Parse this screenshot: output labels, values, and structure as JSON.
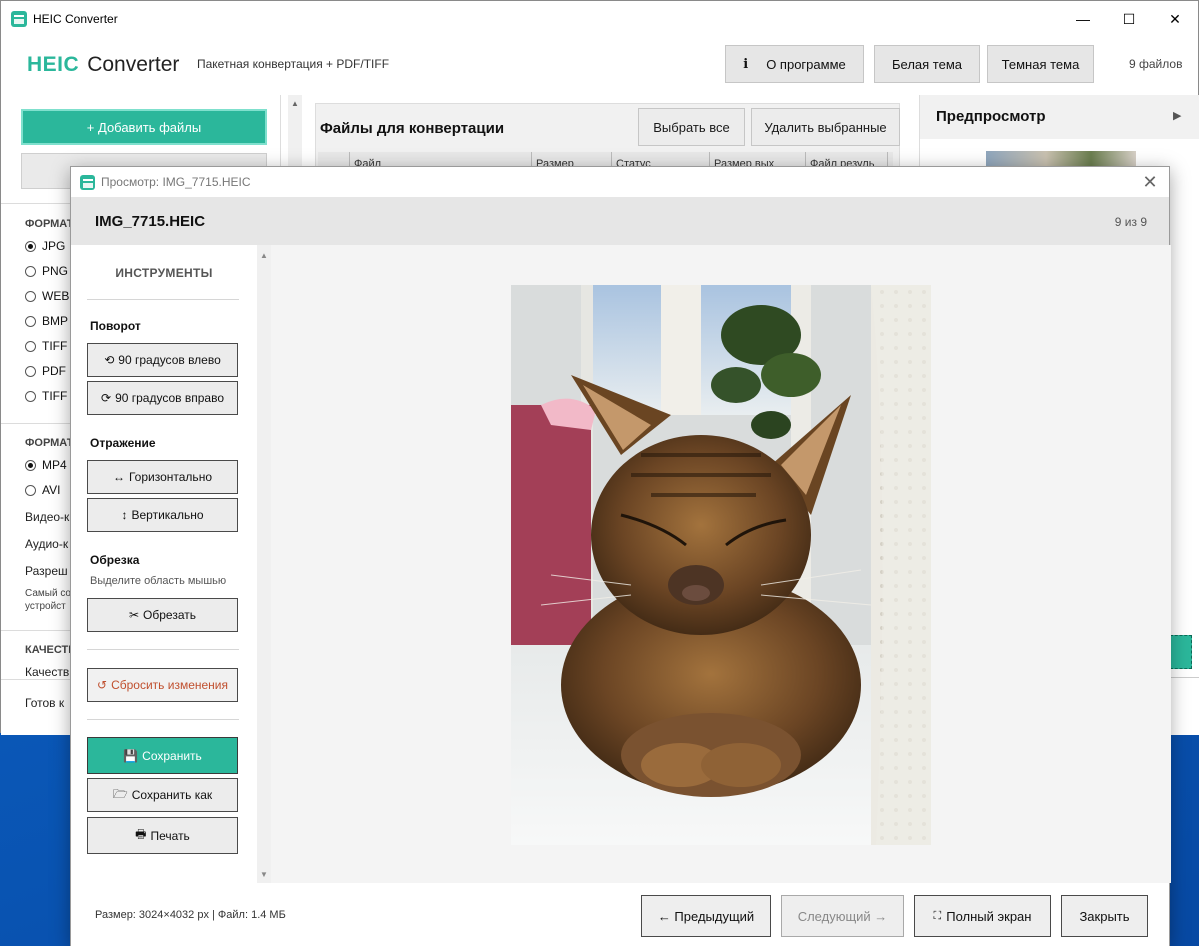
{
  "window": {
    "title": "HEIC Converter",
    "controls": [
      "—",
      "☐",
      "✕"
    ]
  },
  "header": {
    "brand_1": "HEIC",
    "brand_2": "Converter",
    "subtitle": "Пакетная конвертация + PDF/TIFF",
    "about_icon": "i",
    "about_label": "О программе",
    "light_label": "Белая тема",
    "dark_label": "Темная тема",
    "files_count": "9 файлов"
  },
  "left_panel": {
    "add_label": "+  Добавить файлы",
    "format_head_1": "ФОРМАТ",
    "image_formats": [
      {
        "label": "JPG",
        "selected": true
      },
      {
        "label": "PNG",
        "selected": false
      },
      {
        "label": "WEBP",
        "selected": false
      },
      {
        "label": "BMP",
        "selected": false
      },
      {
        "label": "TIFF",
        "selected": false
      },
      {
        "label": "PDF",
        "selected": false
      },
      {
        "label": "TIFF (",
        "selected": false
      }
    ],
    "format_head_2": "ФОРМАТ",
    "video_formats": [
      {
        "label": "MP4",
        "selected": true
      },
      {
        "label": "AVI",
        "selected": false
      }
    ],
    "video_codec": "Видео-к",
    "audio_codec": "Аудио-к",
    "resolution": "Разреш",
    "small_1": "Самый со",
    "small_2": "устройст",
    "quality_head": "КАЧЕСТВ",
    "quality_label": "Качеств",
    "status": "Готов к"
  },
  "center": {
    "title": "Файлы для конвертации",
    "select_all": "Выбрать все",
    "delete_selected": "Удалить выбранные",
    "columns": [
      "",
      "Файл",
      "Размер",
      "Статус",
      "Размер вых",
      "Файл резуль"
    ]
  },
  "right_panel": {
    "title": "Предпросмотр",
    "arrow": "▶"
  },
  "dialog": {
    "title": "Просмотр: IMG_7715.HEIC",
    "close": "✕",
    "file_name": "IMG_7715.HEIC",
    "counter": "9 из 9",
    "tools_title": "ИНСТРУМЕНТЫ",
    "rotation_label": "Поворот",
    "rotate_left": "90 градусов влево",
    "rotate_right": "90 градусов вправо",
    "flip_label": "Отражение",
    "flip_h": "Горизонтально",
    "flip_v": "Вертикально",
    "crop_label": "Обрезка",
    "crop_hint": "Выделите область мышью",
    "crop": "Обрезать",
    "reset": "Сбросить изменения",
    "save": "Сохранить",
    "save_as": "Сохранить как",
    "print": "Печать",
    "info": "Размер: 3024×4032 px  |  Файл: 1.4 МБ",
    "prev": "← Предыдущий",
    "next": "Следующий →",
    "fullscreen": "Полный экран",
    "close_btn": "Закрыть"
  },
  "colors": {
    "accent": "#2bb79b",
    "reset_text": "#c0502f"
  },
  "icons": [
    "app-icon",
    "info-icon",
    "rotate-left-icon",
    "rotate-right-icon",
    "flip-horizontal-icon",
    "flip-vertical-icon",
    "scissors-icon",
    "reset-icon",
    "save-disk-icon",
    "folder-icon",
    "printer-icon",
    "fullscreen-icon",
    "close-icon",
    "chevron-right-icon"
  ]
}
